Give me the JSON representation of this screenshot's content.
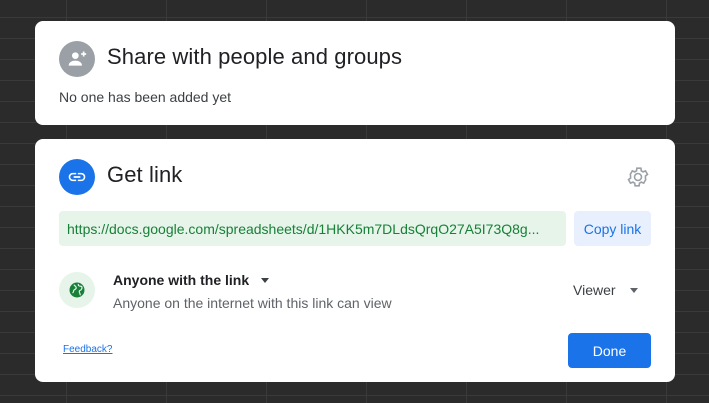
{
  "share_card": {
    "title": "Share with people and groups",
    "empty_text": "No one has been added yet",
    "icon": "person-add-icon"
  },
  "link_card": {
    "title": "Get link",
    "icon": "link-icon",
    "settings_icon": "gear-icon",
    "url": "https://docs.google.com/spreadsheets/d/1HKK5m7DLdsQrqO27A5I73Q8g...",
    "copy_label": "Copy link",
    "access": {
      "label": "Anyone with the link",
      "description": "Anyone on the internet with this link can view",
      "icon": "globe-icon"
    },
    "role": "Viewer",
    "feedback_label": "Feedback?",
    "done_label": "Done"
  },
  "colors": {
    "accent": "#1a73e8",
    "link_green": "#188038",
    "link_bg": "#e6f4ea",
    "copy_bg": "#e8f0fe",
    "backdrop": "#2b2b2b"
  }
}
